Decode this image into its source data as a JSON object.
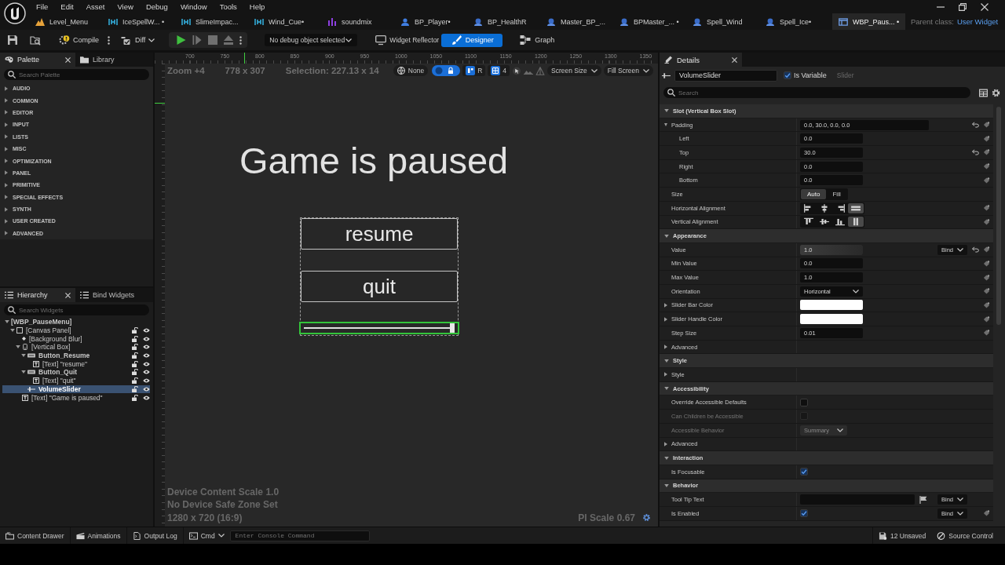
{
  "menu_bar": {
    "items": [
      "File",
      "Edit",
      "Asset",
      "View",
      "Debug",
      "Window",
      "Tools",
      "Help"
    ]
  },
  "document_tabs": [
    {
      "label": "Level_Menu",
      "kind": "level",
      "selected": false
    },
    {
      "label": "IceSpellW... •",
      "kind": "effect",
      "selected": false
    },
    {
      "label": "SlimeImpac...",
      "kind": "effect",
      "selected": false
    },
    {
      "label": "Wind_Cue•",
      "kind": "effect",
      "selected": false
    },
    {
      "label": "soundmix",
      "kind": "mix",
      "selected": false
    },
    {
      "label": "BP_Player•",
      "kind": "pawn",
      "selected": false
    },
    {
      "label": "BP_HealthR",
      "kind": "blueprint",
      "selected": false
    },
    {
      "label": "Master_BP_...",
      "kind": "blueprint",
      "selected": false
    },
    {
      "label": "BPMaster_... •",
      "kind": "blueprint",
      "selected": false
    },
    {
      "label": "Spell_Wind",
      "kind": "blueprint",
      "selected": false
    },
    {
      "label": "Spell_Ice•",
      "kind": "blueprint",
      "selected": false
    },
    {
      "label": "WBP_Paus... •",
      "kind": "widget",
      "selected": true
    }
  ],
  "parent_class": {
    "label": "Parent class:",
    "value": "User Widget"
  },
  "toolbar": {
    "compile": "Compile",
    "diff": "Diff",
    "debug_object": "No debug object selected",
    "widget_reflector": "Widget Reflector",
    "modes": [
      {
        "label": "Designer",
        "selected": true
      },
      {
        "label": "Graph",
        "selected": false
      }
    ]
  },
  "palette": {
    "tabs": [
      {
        "label": "Palette",
        "selected": true
      },
      {
        "label": "Library",
        "selected": false
      }
    ],
    "search": {
      "placeholder": "Search Palette"
    },
    "categories": [
      {
        "label": "AUDIO",
        "expanded": false
      },
      {
        "label": "COMMON",
        "expanded": false
      },
      {
        "label": "EDITOR",
        "expanded": false
      },
      {
        "label": "INPUT",
        "expanded": false
      },
      {
        "label": "LISTS",
        "expanded": false
      },
      {
        "label": "MISC",
        "expanded": false
      },
      {
        "label": "OPTIMIZATION",
        "expanded": false
      },
      {
        "label": "PANEL",
        "expanded": false
      },
      {
        "label": "PRIMITIVE",
        "expanded": false
      },
      {
        "label": "SPECIAL EFFECTS",
        "expanded": false
      },
      {
        "label": "SYNTH",
        "expanded": false
      },
      {
        "label": "USER CREATED",
        "expanded": false
      },
      {
        "label": "ADVANCED",
        "expanded": false
      }
    ]
  },
  "hierarchy": {
    "tabs": [
      {
        "label": "Hierarchy",
        "selected": true
      },
      {
        "label": "Bind Widgets",
        "selected": false
      }
    ],
    "search": {
      "placeholder": "Search Widgets"
    },
    "tree": [
      {
        "label": "[WBP_PauseMenu]",
        "kind": "root",
        "expanded": true,
        "selected": false,
        "is_variable": true,
        "children": [
          {
            "label": "[Canvas Panel]",
            "kind": "canvas",
            "expanded": true,
            "selected": false,
            "is_variable": false,
            "children": [
              {
                "label": "[Background Blur]",
                "kind": "blur",
                "selected": false,
                "is_variable": false
              },
              {
                "label": "[Vertical Box]",
                "kind": "vbox",
                "expanded": true,
                "selected": false,
                "is_variable": false,
                "children": [
                  {
                    "label": "Button_Resume",
                    "kind": "button",
                    "expanded": true,
                    "selected": false,
                    "is_variable": true,
                    "children": [
                      {
                        "label": "[Text] \"resume\"",
                        "kind": "text",
                        "selected": false,
                        "is_variable": false
                      }
                    ]
                  },
                  {
                    "label": "Button_Quit",
                    "kind": "button",
                    "expanded": true,
                    "selected": false,
                    "is_variable": true,
                    "children": [
                      {
                        "label": "[Text] \"quit\"",
                        "kind": "text",
                        "selected": false,
                        "is_variable": false
                      }
                    ]
                  },
                  {
                    "label": "VolumeSlider",
                    "kind": "slider",
                    "selected": true,
                    "is_variable": true
                  }
                ]
              },
              {
                "label": "[Text] \"Game is paused\"",
                "kind": "text",
                "selected": false,
                "is_variable": false
              }
            ]
          }
        ]
      }
    ]
  },
  "canvas": {
    "ruler": [
      "700",
      "750",
      "800",
      "850",
      "900",
      "950",
      "1000",
      "1050",
      "1100",
      "1150",
      "1200",
      "1250",
      "1300",
      "1350"
    ],
    "zoom": "Zoom +4",
    "resolution": "778 x 307",
    "selection": "Selection: 227.13 x 14",
    "controls": {
      "culture": "None",
      "lock_toggle": {
        "on": true
      },
      "r_toggle": {
        "label": "R",
        "on": true
      },
      "grid_snap": {
        "label": "4",
        "on": true
      },
      "screen_size": "Screen Size",
      "fill_screen": "Fill Screen"
    },
    "widget": {
      "title": "Game is paused",
      "buttons": [
        "resume",
        "quit"
      ],
      "slider": {
        "level": 1,
        "selected": true
      }
    },
    "info": [
      "Device Content Scale 1.0",
      "No Device Safe Zone Set",
      "1280 x 720 (16:9)"
    ],
    "dpi_scale": "PI Scale 0.67"
  },
  "details": {
    "tab": "Details",
    "name": {
      "value": "VolumeSlider"
    },
    "is_variable": {
      "label": "Is Variable",
      "checked": true
    },
    "class_name": "Slider",
    "search": {
      "placeholder": "Search"
    },
    "sections": [
      {
        "label": "Slot (Vertical Box Slot)",
        "expanded": true,
        "rows": [
          {
            "label": "Padding",
            "kind": "struct",
            "value": "0.0, 30.0, 0.0, 0.0",
            "expanded": true,
            "reset": true,
            "animatable": true,
            "disabled": false,
            "children": [
              {
                "label": "Left",
                "kind": "number",
                "value": "0.0",
                "reset": false,
                "animatable": true,
                "disabled": false
              },
              {
                "label": "Top",
                "kind": "number",
                "value": "30.0",
                "reset": true,
                "animatable": true,
                "disabled": false
              },
              {
                "label": "Right",
                "kind": "number",
                "value": "0.0",
                "reset": false,
                "animatable": true,
                "disabled": false
              },
              {
                "label": "Bottom",
                "kind": "number",
                "value": "0.0",
                "reset": false,
                "animatable": true,
                "disabled": false
              }
            ]
          },
          {
            "label": "Size",
            "kind": "segmented",
            "options": [
              {
                "label": "Auto",
                "selected": true
              },
              {
                "label": "Fill",
                "selected": false
              }
            ],
            "reset": false,
            "animatable": false,
            "disabled": false
          },
          {
            "label": "Horizontal Alignment",
            "kind": "alignment",
            "options": [
              {
                "kind": "left",
                "selected": false
              },
              {
                "kind": "center",
                "selected": false
              },
              {
                "kind": "right",
                "selected": false
              },
              {
                "kind": "fill",
                "selected": true
              }
            ],
            "reset": false,
            "animatable": true,
            "disabled": false
          },
          {
            "label": "Vertical Alignment",
            "kind": "alignment",
            "options": [
              {
                "kind": "top",
                "selected": false
              },
              {
                "kind": "middle",
                "selected": false
              },
              {
                "kind": "bottom",
                "selected": false
              },
              {
                "kind": "fill_vertical",
                "selected": true
              }
            ],
            "reset": false,
            "animatable": true,
            "disabled": false
          }
        ]
      },
      {
        "label": "Appearance",
        "expanded": true,
        "rows": [
          {
            "label": "Value",
            "kind": "spin",
            "value": "1.0",
            "level": 1,
            "bind": "Bind",
            "reset": true,
            "animatable": true,
            "disabled": false
          },
          {
            "label": "Min Value",
            "kind": "number",
            "value": "0.0",
            "reset": false,
            "animatable": true,
            "disabled": false
          },
          {
            "label": "Max Value",
            "kind": "number",
            "value": "1.0",
            "reset": false,
            "animatable": true,
            "disabled": false
          },
          {
            "label": "Orientation",
            "kind": "dropdown",
            "value": "Horizontal",
            "reset": false,
            "animatable": true,
            "disabled": false
          },
          {
            "label": "Slider Bar Color",
            "kind": "color",
            "color": "#ffffff",
            "expanded": false,
            "reset": false,
            "animatable": true,
            "disabled": false
          },
          {
            "label": "Slider Handle Color",
            "kind": "color",
            "color": "#ffffff",
            "expanded": false,
            "reset": false,
            "animatable": true,
            "disabled": false
          },
          {
            "label": "Step Size",
            "kind": "number",
            "value": "0.01",
            "reset": false,
            "animatable": true,
            "disabled": false
          },
          {
            "label": "Advanced",
            "kind": "group",
            "expanded": false,
            "reset": false,
            "animatable": false,
            "disabled": false
          }
        ]
      },
      {
        "label": "Style",
        "expanded": true,
        "rows": [
          {
            "label": "Style",
            "kind": "group",
            "expanded": false,
            "reset": false,
            "animatable": false,
            "disabled": false
          }
        ]
      },
      {
        "label": "Accessibility",
        "expanded": true,
        "rows": [
          {
            "label": "Override Accessible Defaults",
            "kind": "checkbox",
            "checked": false,
            "reset": false,
            "animatable": false,
            "disabled": false
          },
          {
            "label": "Can Children be Accessible",
            "kind": "checkbox",
            "checked": false,
            "reset": false,
            "animatable": false,
            "disabled": true
          },
          {
            "label": "Accessible Behavior",
            "kind": "dropdown",
            "value": "Summary",
            "reset": false,
            "animatable": false,
            "disabled": true
          },
          {
            "label": "Advanced",
            "kind": "group",
            "expanded": false,
            "reset": false,
            "animatable": false,
            "disabled": false
          }
        ]
      },
      {
        "label": "Interaction",
        "expanded": true,
        "rows": [
          {
            "label": "Is Focusable",
            "kind": "checkbox",
            "checked": true,
            "reset": false,
            "animatable": false,
            "disabled": false
          }
        ]
      },
      {
        "label": "Behavior",
        "expanded": true,
        "rows": [
          {
            "label": "Tool Tip Text",
            "kind": "localized",
            "bind": "Bind",
            "reset": false,
            "animatable": false,
            "disabled": false
          },
          {
            "label": "Is Enabled",
            "kind": "checkbox",
            "checked": true,
            "bind": "Bind",
            "reset": false,
            "animatable": true,
            "disabled": false
          }
        ]
      }
    ]
  },
  "status_bar": {
    "buttons": [
      {
        "label": "Content Drawer",
        "kind": "drawer"
      },
      {
        "label": "Animations",
        "kind": "animations"
      },
      {
        "label": "Output Log",
        "kind": "log"
      }
    ],
    "cmd": "Cmd",
    "console": {
      "placeholder": "Enter Console Command"
    },
    "unsaved": "12 Unsaved",
    "source_control": "Source Control"
  }
}
